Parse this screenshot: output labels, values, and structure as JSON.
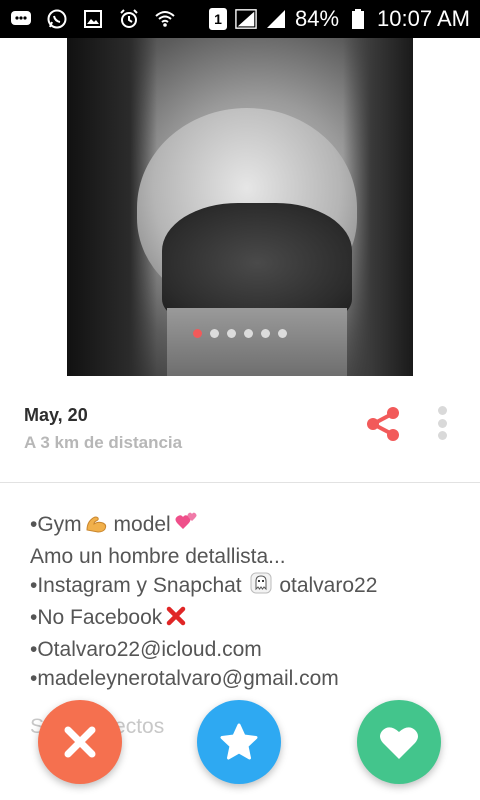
{
  "status_bar": {
    "left_icons": [
      "messages-icon",
      "whatsapp-icon",
      "gallery-icon",
      "alarm-icon",
      "wifi-icon"
    ],
    "sim_slot": "1",
    "battery": "84%",
    "time": "10:07 AM"
  },
  "photo": {
    "page_dots_total": 6,
    "active_index": 0
  },
  "profile": {
    "name_age": "May, 20",
    "distance": "A 3 km de distancia"
  },
  "bio": {
    "lines": [
      "•Gym",
      "model",
      "Amo un hombre detallista...",
      "•Instagram y Snapchat",
      "otalvaro22",
      "•No Facebook",
      "•Otalvaro22@icloud.com",
      "•madeleynerotalvaro@gmail.com"
    ],
    "faded_partial": "S        directos"
  },
  "actions": {
    "nope": "nope",
    "superlike": "super like",
    "like": "like"
  },
  "colors": {
    "accent_red": "#f25a5a",
    "nope": "#f5704f",
    "superlike": "#2ea9f2",
    "like": "#43c58c"
  }
}
